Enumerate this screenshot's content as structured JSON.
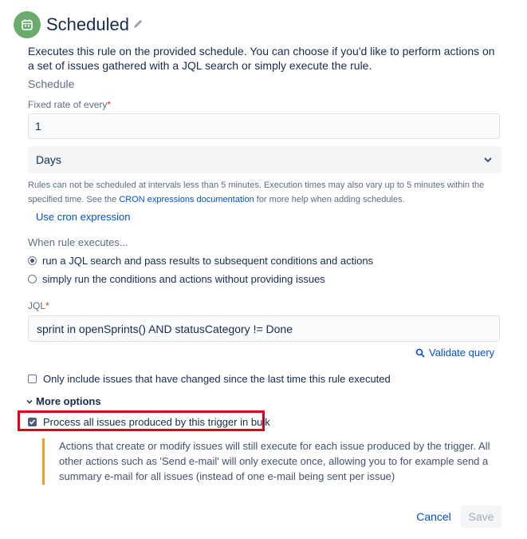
{
  "header": {
    "title": "Scheduled",
    "description": "Executes this rule on the provided schedule. You can choose if you'd like to perform actions on a set of issues gathered with a JQL search or simply execute the rule."
  },
  "schedule": {
    "section_label": "Schedule",
    "rate_label": "Fixed rate of every",
    "required_marker": "*",
    "rate_value": "1",
    "unit_selected": "Days",
    "help_text_before": "Rules can not be scheduled at intervals less than 5 minutes. Execution times may also vary up to 5 minutes within the specified time. See the ",
    "help_link": "CRON expressions documentation",
    "help_text_after": " for more help when adding schedules.",
    "cron_link": "Use cron expression"
  },
  "execution": {
    "label": "When rule executes...",
    "option_jql": "run a JQL search and pass results to subsequent conditions and actions",
    "option_simple": "simply run the conditions and actions without providing issues"
  },
  "jql": {
    "label": "JQL",
    "required_marker": "*",
    "value": "sprint in openSprints() AND statusCategory != Done",
    "validate_label": "Validate query"
  },
  "options": {
    "only_changed_label": "Only include issues that have changed since the last time this rule executed",
    "more_options_label": "More options",
    "bulk_label": "Process all issues produced by this trigger in bulk",
    "bulk_info": "Actions that create or modify issues will still execute for each issue produced by the trigger. All other actions such as 'Send e-mail' will only execute once, allowing you to for example send a summary e-mail for all issues (instead of one e-mail being sent per issue)"
  },
  "footer": {
    "cancel_label": "Cancel",
    "save_label": "Save"
  },
  "colors": {
    "trigger_icon_bg": "#6aac6d",
    "link": "#0052cc",
    "highlight": "#e0001b",
    "info_border": "#ff991f"
  },
  "icons": {
    "trigger": "calendar-icon",
    "edit": "pencil-icon",
    "dropdown": "chevron-down-icon",
    "validate": "search-icon",
    "more_options": "chevron-down-icon"
  }
}
